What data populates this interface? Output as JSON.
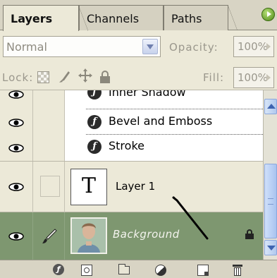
{
  "tabs": [
    {
      "label": "Layers",
      "active": true
    },
    {
      "label": "Channels",
      "active": false
    },
    {
      "label": "Paths",
      "active": false
    }
  ],
  "blend": {
    "mode": "Normal",
    "opacity_label": "Opacity:",
    "opacity_value": "100%"
  },
  "lock": {
    "label": "Lock:",
    "fill_label": "Fill:",
    "fill_value": "100%"
  },
  "effects": [
    {
      "label": "Inner Shadow",
      "icon": "fx-icon"
    },
    {
      "label": "Bevel and Emboss",
      "icon": "fx-icon"
    },
    {
      "label": "Stroke",
      "icon": "fx-icon"
    }
  ],
  "layers": [
    {
      "name": "Layer 1",
      "type": "text",
      "thumb_glyph": "T",
      "selected": false,
      "visible": true
    },
    {
      "name": "Background",
      "type": "image",
      "selected": true,
      "visible": true,
      "locked": true
    }
  ],
  "toolbar": [
    "link-layers-icon",
    "add-mask-icon",
    "new-group-icon",
    "adjustment-layer-icon",
    "new-layer-icon",
    "trash-icon"
  ],
  "colors": {
    "panel_bg": "#ece9d8",
    "selected_row": "#7e9770",
    "scrollbar_accent": "#3e63b0"
  }
}
